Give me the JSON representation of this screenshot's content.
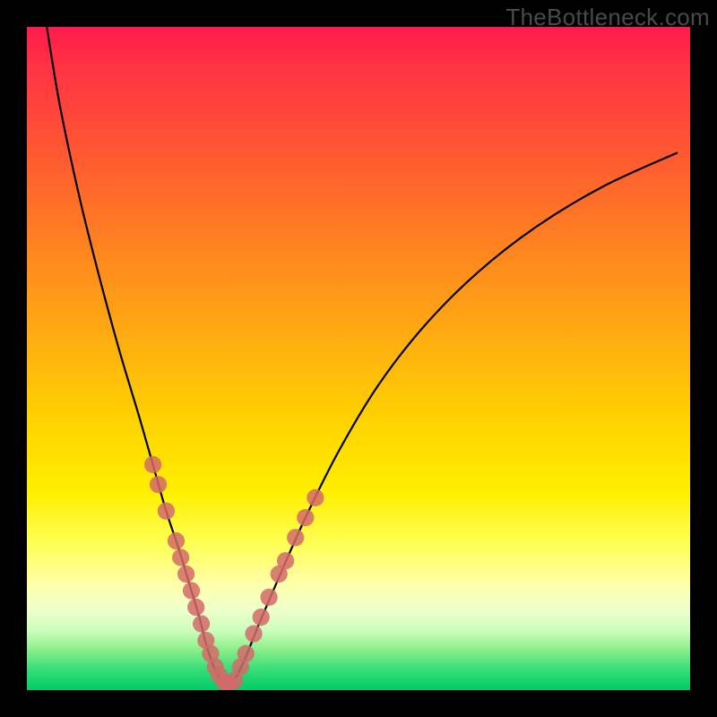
{
  "watermark": "TheBottleneck.com",
  "chart_data": {
    "type": "line",
    "title": "",
    "xlabel": "",
    "ylabel": "",
    "xlim": [
      0,
      100
    ],
    "ylim": [
      0,
      100
    ],
    "grid": false,
    "legend": false,
    "series": [
      {
        "name": "curve",
        "x": [
          3,
          5,
          8,
          11,
          14,
          17,
          19,
          21,
          23,
          24.5,
          26,
          27,
          28,
          29,
          30,
          31.5,
          33,
          35,
          38,
          42,
          47,
          53,
          60,
          68,
          77,
          87,
          98
        ],
        "y": [
          100,
          88,
          74,
          62,
          51,
          41,
          34,
          27,
          21,
          16,
          11,
          7,
          4,
          2,
          1,
          2,
          5,
          10,
          17,
          26,
          36,
          46,
          55,
          63,
          70,
          76,
          81
        ]
      }
    ],
    "markers": {
      "color": "#d46a6a",
      "radius": 1.3,
      "points": [
        {
          "x": 19.0,
          "y": 34
        },
        {
          "x": 19.8,
          "y": 31
        },
        {
          "x": 21.0,
          "y": 27
        },
        {
          "x": 22.5,
          "y": 22.5
        },
        {
          "x": 23.2,
          "y": 20
        },
        {
          "x": 24.0,
          "y": 17.5
        },
        {
          "x": 24.8,
          "y": 15
        },
        {
          "x": 25.5,
          "y": 12.5
        },
        {
          "x": 26.3,
          "y": 10
        },
        {
          "x": 27.0,
          "y": 7.5
        },
        {
          "x": 27.7,
          "y": 5.5
        },
        {
          "x": 28.4,
          "y": 3.5
        },
        {
          "x": 29.0,
          "y": 2.2
        },
        {
          "x": 29.8,
          "y": 1.2
        },
        {
          "x": 30.5,
          "y": 1.0
        },
        {
          "x": 31.3,
          "y": 1.5
        },
        {
          "x": 32.2,
          "y": 3.5
        },
        {
          "x": 33.0,
          "y": 5.5
        },
        {
          "x": 34.2,
          "y": 8.5
        },
        {
          "x": 35.3,
          "y": 11
        },
        {
          "x": 36.5,
          "y": 14
        },
        {
          "x": 38.0,
          "y": 17.5
        },
        {
          "x": 39.0,
          "y": 19.5
        },
        {
          "x": 40.5,
          "y": 23
        },
        {
          "x": 42.0,
          "y": 26
        },
        {
          "x": 43.5,
          "y": 29
        }
      ]
    }
  }
}
